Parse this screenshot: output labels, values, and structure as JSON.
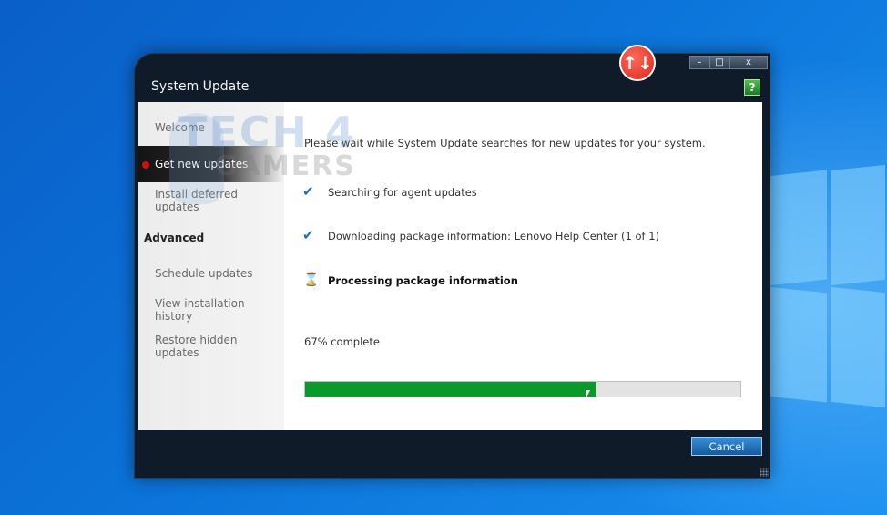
{
  "window": {
    "title": "System Update",
    "controls": {
      "minimize": "–",
      "maximize": "□",
      "close": "x"
    }
  },
  "icons": {
    "update_badge": "↑↓",
    "help": "?",
    "check": "✔",
    "hourglass": "⌛"
  },
  "sidebar": {
    "items": [
      {
        "label": "Welcome"
      },
      {
        "label": "Get new updates",
        "active": true
      },
      {
        "label": "Install deferred updates"
      }
    ],
    "advanced_heading": "Advanced",
    "advanced_items": [
      {
        "label": "Schedule updates"
      },
      {
        "label": "View installation history"
      },
      {
        "label": "Restore hidden updates"
      }
    ]
  },
  "content": {
    "intro": "Please wait while System Update searches for new updates for your system.",
    "steps": [
      {
        "label": "Searching for agent updates",
        "status": "done"
      },
      {
        "label": "Downloading package information: Lenovo Help Center (1 of 1)",
        "status": "done"
      },
      {
        "label": "Processing package information",
        "status": "in-progress"
      }
    ],
    "percent_text": "67% complete",
    "progress_fraction": 0.67
  },
  "footer": {
    "cancel_label": "Cancel"
  },
  "watermark": {
    "line1": "TECH 4",
    "line2": "GAMERS"
  },
  "colors": {
    "progress_fill": "#0a9a2c",
    "active_dot": "#d10f0f",
    "check": "#1a6fd1",
    "cancel_button": "#2a78c2"
  }
}
